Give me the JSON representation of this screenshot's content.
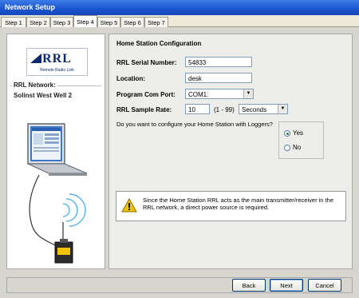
{
  "window": {
    "title": "Network Setup"
  },
  "tabs": [
    "Step 1",
    "Step 2",
    "Step 3",
    "Step 4",
    "Step 5",
    "Step 6",
    "Step 7"
  ],
  "active_tab": "Step 4",
  "sidebar": {
    "logo_text": "RRL",
    "logo_subtitle": "Remote Radio Link",
    "network_label": "RRL Network:",
    "network_name": "Solinst West Well 2"
  },
  "form": {
    "section_title": "Home Station Configuration",
    "serial_label": "RRL Serial Number:",
    "serial_value": "54833",
    "location_label": "Location:",
    "location_value": "desk",
    "com_port_label": "Program Com Port:",
    "com_port_value": "COM1:",
    "sample_rate_label": "RRL Sample Rate:",
    "sample_rate_value": "10",
    "sample_rate_range": "(1 - 99)",
    "sample_rate_unit": "Seconds",
    "question": "Do you want to configure your Home Station with Loggers?",
    "radio_yes": "Yes",
    "radio_no": "No",
    "selected_option": "Yes"
  },
  "notice": {
    "text": "Since the Home Station RRL acts as the main transmitter/receiver in the RRL network, a direct power source is required."
  },
  "buttons": {
    "back": "Back",
    "next": "Next",
    "cancel": "Cancel"
  },
  "colors": {
    "titlebar": "#1a53d0",
    "warning": "#f2c300"
  }
}
